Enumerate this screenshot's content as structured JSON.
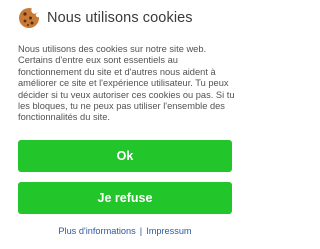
{
  "dialog": {
    "title": "Nous utilisons cookies",
    "icon": "cookie-icon",
    "body": "Nous utilisons des cookies sur notre site web. Certains d'entre eux sont essentiels au fonctionnement du site et d'autres nous aident à améliorer ce site et l'expérience utilisateur. Tu peux décider si tu veux autoriser ces cookies ou pas. Si tu les bloques, tu ne peux pas utiliser l'ensemble des fonctionnalités du site."
  },
  "buttons": {
    "ok_label": "Ok",
    "refuse_label": "Je refuse"
  },
  "footer": {
    "more_info_label": "Plus d'informations",
    "separator": "|",
    "impressum_label": "Impressum"
  },
  "colors": {
    "button_green": "#22c52a",
    "link_blue": "#2c5aa0",
    "cookie_brown": "#b56a2c"
  }
}
